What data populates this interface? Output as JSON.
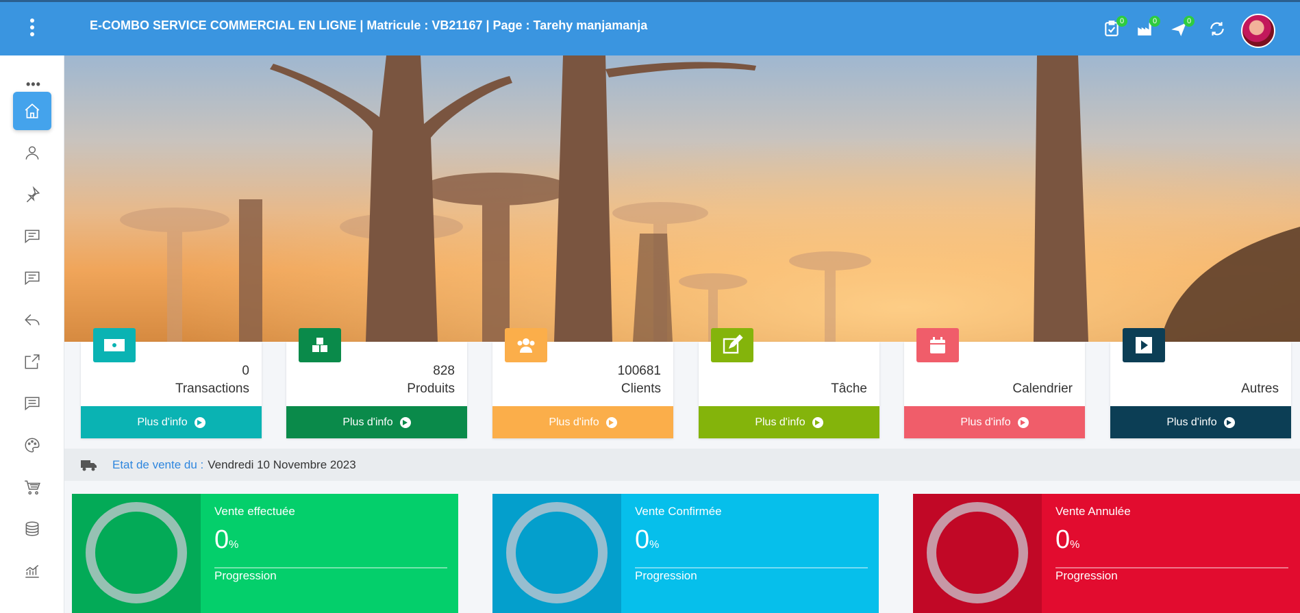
{
  "header": {
    "title": "E-COMBO  SERVICE COMMERCIAL EN LIGNE | Matricule : VB21167 | Page : Tarehy manjamanja",
    "badges": [
      "0",
      "0",
      "0"
    ],
    "icons": [
      "tasks-check-icon",
      "factory-icon",
      "plane-icon",
      "sync-icon"
    ]
  },
  "sidebar": {
    "more": "•••",
    "items": [
      "home-icon",
      "user-icon",
      "pin-icon",
      "message-icon",
      "message-alt-icon",
      "reply-icon",
      "share-icon",
      "comment-icon",
      "palette-icon",
      "cart-icon",
      "coins-icon",
      "chart-icon"
    ]
  },
  "stats": [
    {
      "value": "0",
      "label": "Transactions",
      "footer": "Plus d'info",
      "color": "#0ab3b3",
      "icon": "money-icon"
    },
    {
      "value": "828",
      "label": "Produits",
      "footer": "Plus d'info",
      "color": "#0a8a4a",
      "icon": "cubes-icon"
    },
    {
      "value": "100681",
      "label": "Clients",
      "footer": "Plus d'info",
      "color": "#fbae4a",
      "icon": "users-icon"
    },
    {
      "value": "",
      "label": "Tâche",
      "footer": "Plus d'info",
      "color": "#84b40b",
      "icon": "edit-icon"
    },
    {
      "value": "",
      "label": "Calendrier",
      "footer": "Plus d'info",
      "color": "#f05d6a",
      "icon": "calendar-icon"
    },
    {
      "value": "",
      "label": "Autres",
      "footer": "Plus d'info",
      "color": "#0c3e55",
      "icon": "play-icon"
    }
  ],
  "etat": {
    "label": "Etat de vente du :",
    "date": "Vendredi 10 Novembre 2023"
  },
  "sales": [
    {
      "title": "Vente effectuée",
      "percent": "0",
      "unit": "%",
      "progress": "Progression",
      "color": "#04cf6b",
      "dark": "#03aa57"
    },
    {
      "title": "Vente Confirmée",
      "percent": "0",
      "unit": "%",
      "progress": "Progression",
      "color": "#06bfeb",
      "dark": "#049fcc"
    },
    {
      "title": "Vente Annulée",
      "percent": "0",
      "unit": "%",
      "progress": "Progression",
      "color": "#e20c2f",
      "dark": "#c10826"
    }
  ]
}
